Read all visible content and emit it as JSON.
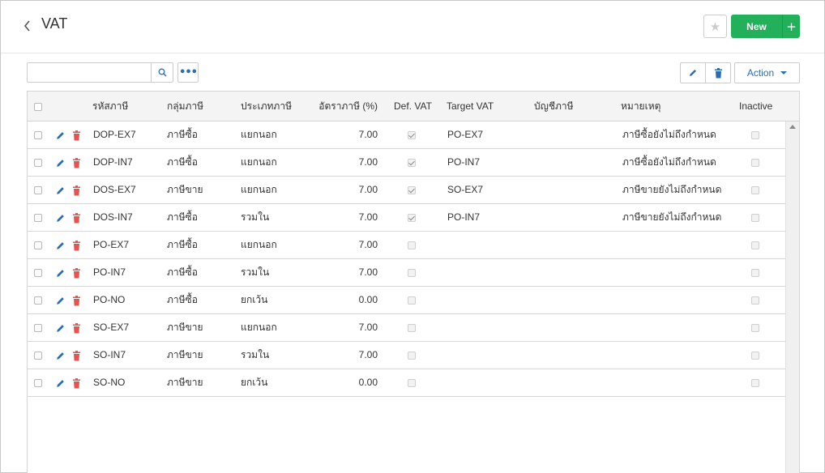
{
  "header": {
    "title": "VAT",
    "back_icon": "chevron-left-icon",
    "new_label": "New",
    "new_plus": "+"
  },
  "toolbar": {
    "search_placeholder": "",
    "more_label": "•••",
    "action_label": "Action"
  },
  "colors": {
    "accent_green": "#22b05b",
    "link_blue": "#2a6db5",
    "delete_red": "#e8534f"
  },
  "columns": {
    "code": "รหัสภาษี",
    "group": "กลุ่มภาษี",
    "type": "ประเภทภาษี",
    "rate": "อัตราภาษี (%)",
    "def_vat": "Def. VAT",
    "target_vat": "Target VAT",
    "account": "บัญชีภาษี",
    "note": "หมายเหตุ",
    "inactive": "Inactive"
  },
  "rows": [
    {
      "code": "DOP-EX7",
      "group": "ภาษีซื้อ",
      "type": "แยกนอก",
      "rate": "7.00",
      "def_vat": true,
      "target": "PO-EX7",
      "account": "",
      "note": "ภาษีซื้อยังไม่ถึงกำหนด",
      "inactive": false
    },
    {
      "code": "DOP-IN7",
      "group": "ภาษีซื้อ",
      "type": "แยกนอก",
      "rate": "7.00",
      "def_vat": true,
      "target": "PO-IN7",
      "account": "",
      "note": "ภาษีซื้อยังไม่ถึงกำหนด",
      "inactive": false
    },
    {
      "code": "DOS-EX7",
      "group": "ภาษีขาย",
      "type": "แยกนอก",
      "rate": "7.00",
      "def_vat": true,
      "target": "SO-EX7",
      "account": "",
      "note": "ภาษีขายยังไม่ถึงกำหนด",
      "inactive": false
    },
    {
      "code": "DOS-IN7",
      "group": "ภาษีซื้อ",
      "type": "รวมใน",
      "rate": "7.00",
      "def_vat": true,
      "target": "PO-IN7",
      "account": "",
      "note": "ภาษีขายยังไม่ถึงกำหนด",
      "inactive": false
    },
    {
      "code": "PO-EX7",
      "group": "ภาษีซื้อ",
      "type": "แยกนอก",
      "rate": "7.00",
      "def_vat": false,
      "target": "",
      "account": "",
      "note": "",
      "inactive": false
    },
    {
      "code": "PO-IN7",
      "group": "ภาษีซื้อ",
      "type": "รวมใน",
      "rate": "7.00",
      "def_vat": false,
      "target": "",
      "account": "",
      "note": "",
      "inactive": false
    },
    {
      "code": "PO-NO",
      "group": "ภาษีซื้อ",
      "type": "ยกเว้น",
      "rate": "0.00",
      "def_vat": false,
      "target": "",
      "account": "",
      "note": "",
      "inactive": false
    },
    {
      "code": "SO-EX7",
      "group": "ภาษีขาย",
      "type": "แยกนอก",
      "rate": "7.00",
      "def_vat": false,
      "target": "",
      "account": "",
      "note": "",
      "inactive": false
    },
    {
      "code": "SO-IN7",
      "group": "ภาษีขาย",
      "type": "รวมใน",
      "rate": "7.00",
      "def_vat": false,
      "target": "",
      "account": "",
      "note": "",
      "inactive": false
    },
    {
      "code": "SO-NO",
      "group": "ภาษีขาย",
      "type": "ยกเว้น",
      "rate": "0.00",
      "def_vat": false,
      "target": "",
      "account": "",
      "note": "",
      "inactive": false
    }
  ]
}
